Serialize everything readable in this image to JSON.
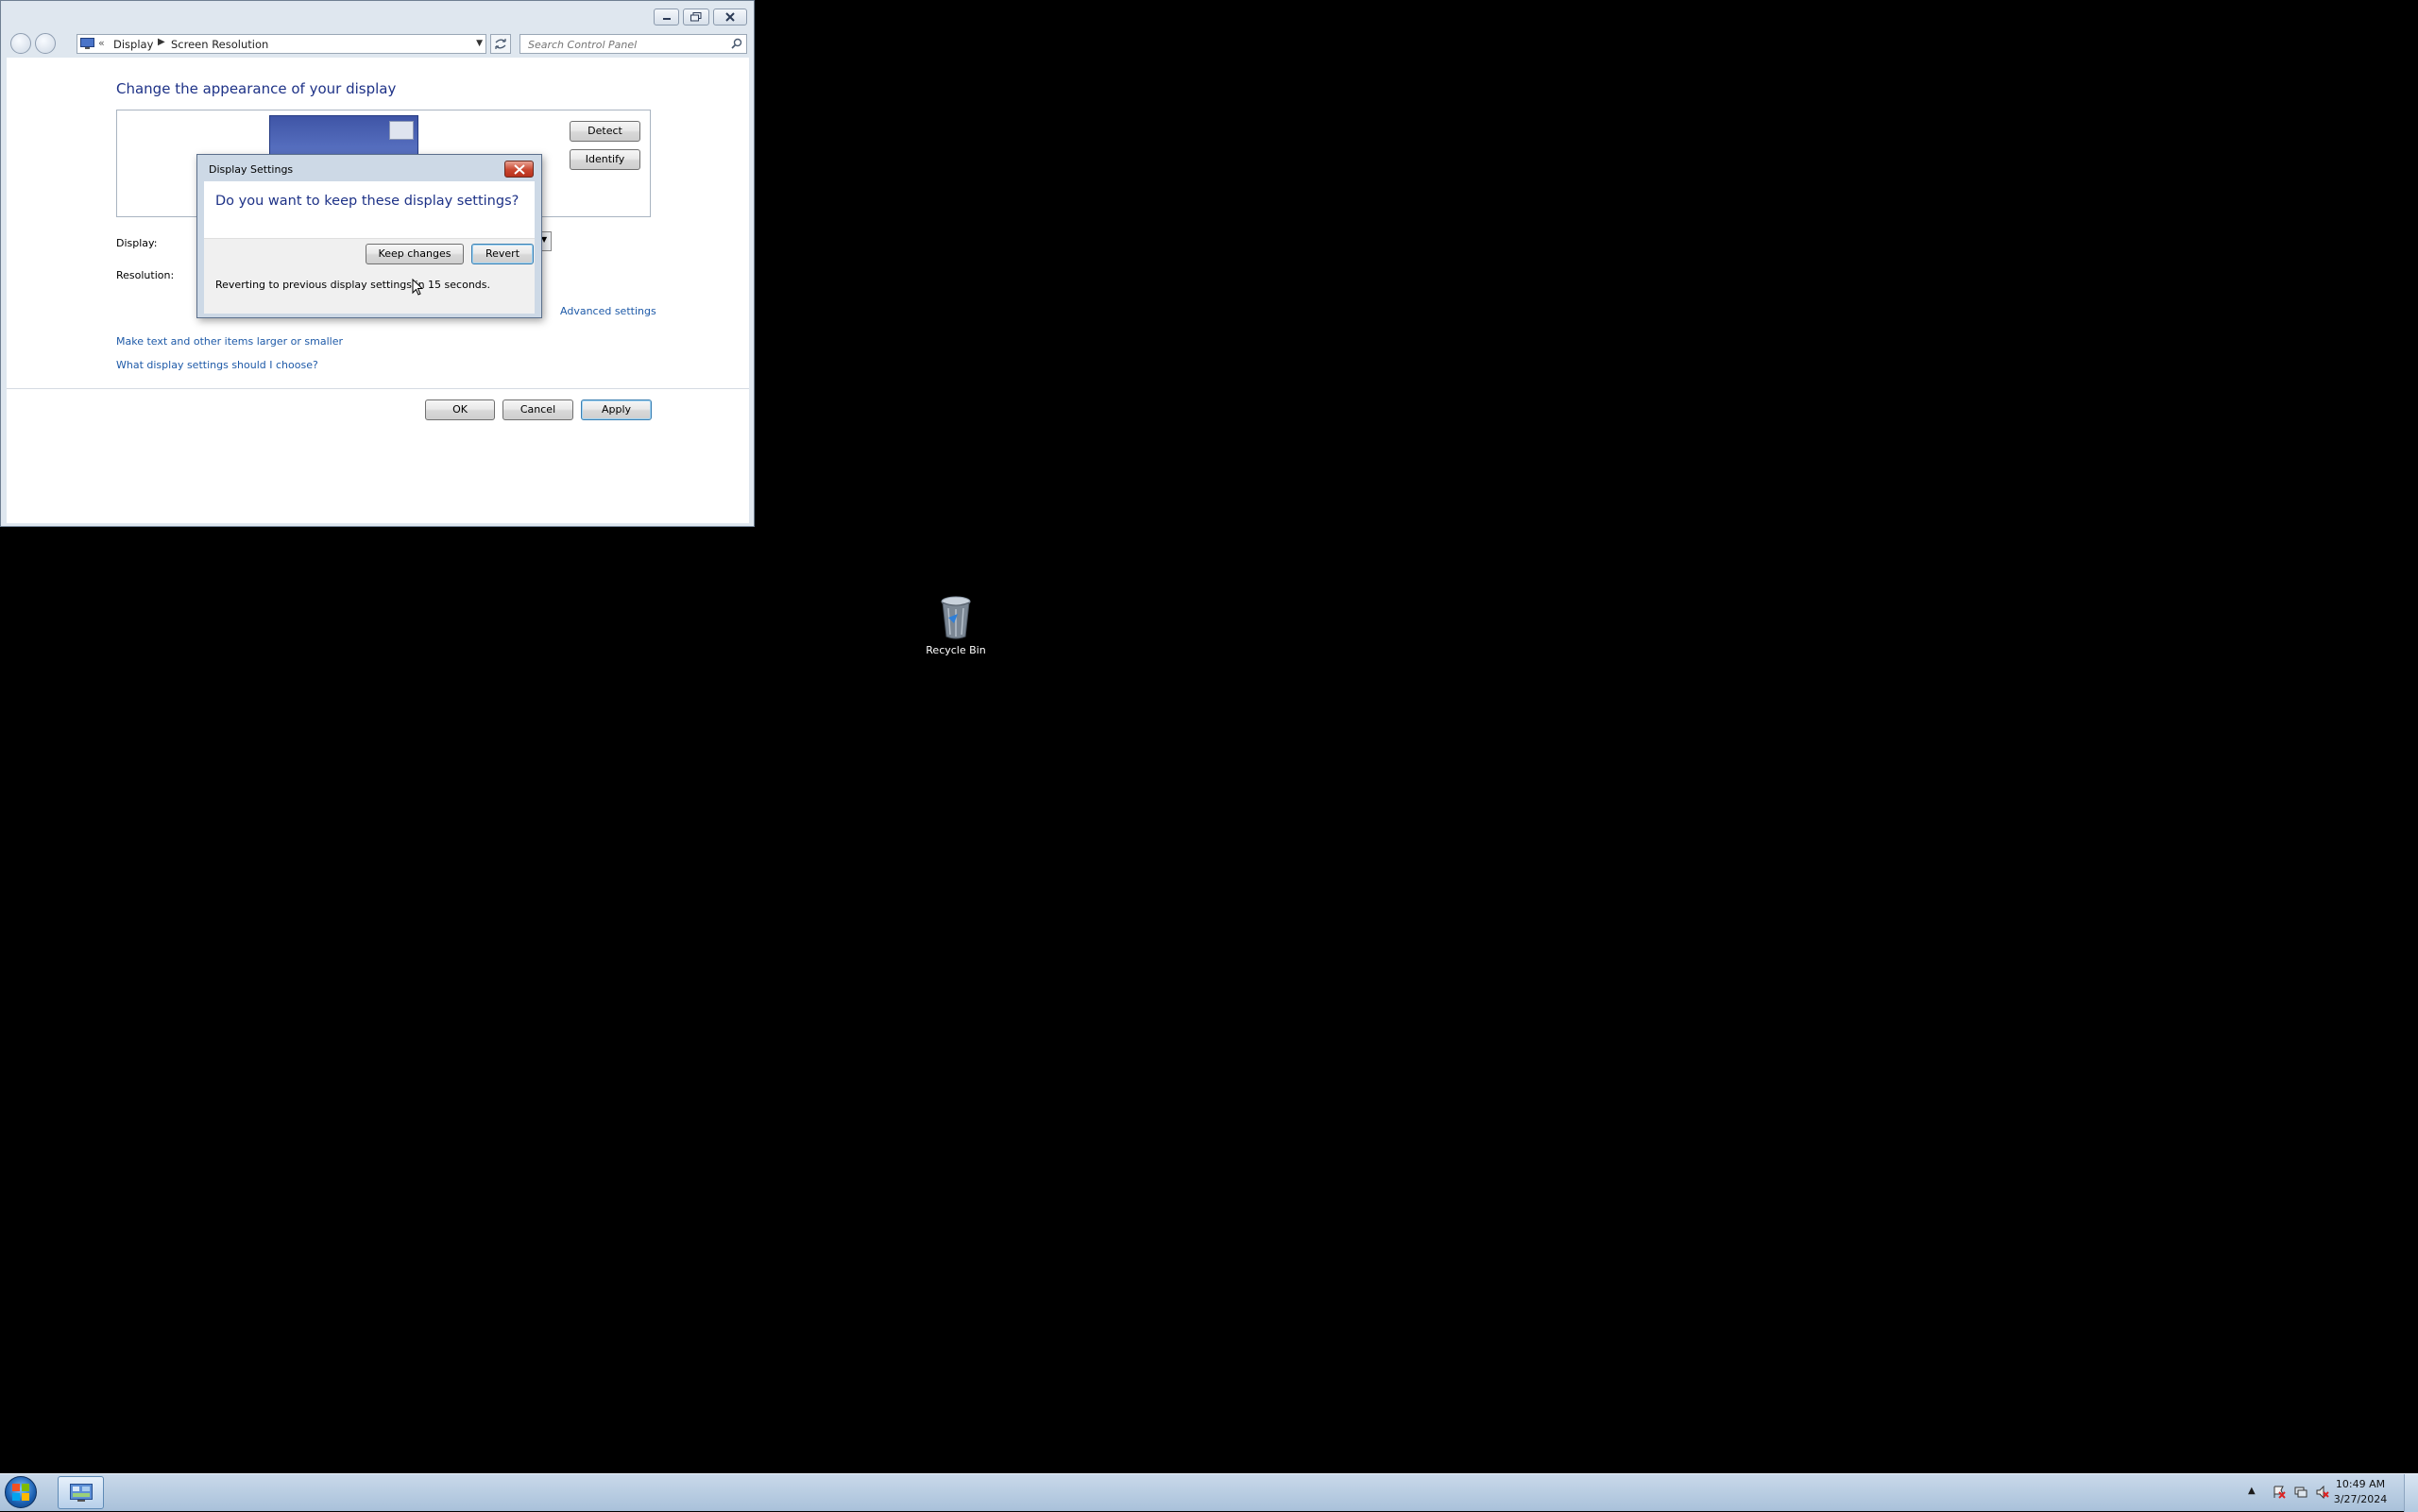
{
  "window": {
    "address": {
      "crumbs": [
        "Display",
        "Screen Resolution"
      ]
    },
    "search": {
      "placeholder": "Search Control Panel"
    },
    "page_title": "Change the appearance of your display",
    "detect_label": "Detect",
    "identify_label": "Identify",
    "display_label": "Display:",
    "resolution_label": "Resolution:",
    "advanced_link": "Advanced settings",
    "links": [
      "Make text and other items larger or smaller",
      "What display settings should I choose?"
    ],
    "ok_label": "OK",
    "cancel_label": "Cancel",
    "apply_label": "Apply"
  },
  "dialog": {
    "title": "Display Settings",
    "question": "Do you want to keep these display settings?",
    "keep_label": "Keep changes",
    "revert_label": "Revert",
    "message": "Reverting to previous display settings in 15 seconds."
  },
  "desktop": {
    "icons": [
      {
        "label": "Recycle Bin",
        "icon": "recycle-bin-icon"
      }
    ]
  },
  "taskbar": {
    "time": "10:49 AM",
    "date": "3/27/2024",
    "apps": [
      {
        "icon": "control-panel-icon"
      }
    ]
  },
  "colors": {
    "title_blue": "#1e3287",
    "link_blue": "#1e5aa8",
    "desktop": "#000000",
    "taskbar": "#b9cde2"
  }
}
